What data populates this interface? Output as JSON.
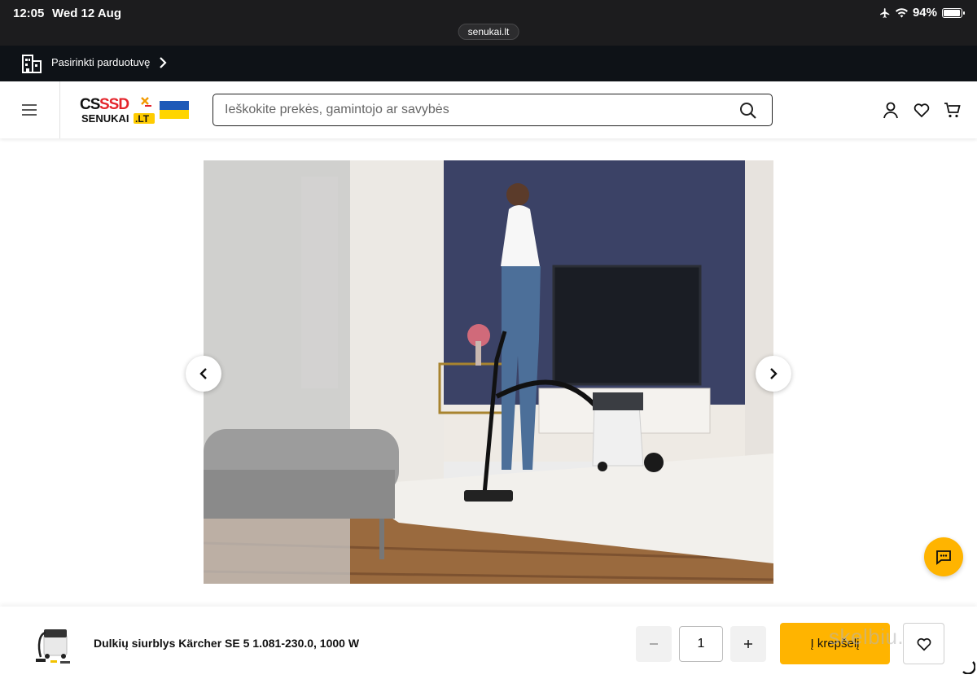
{
  "status_bar": {
    "time": "12:05",
    "date": "Wed 12 Aug",
    "battery": "94%",
    "battery_level": 0.94
  },
  "browser": {
    "url": "senukai.lt"
  },
  "store_bar": {
    "label": "Pasirinkti parduotuvę"
  },
  "header": {
    "search_placeholder": "Ieškokite prekės, gamintojo ar savybės",
    "logo_text": "SENUKAI.LT"
  },
  "product": {
    "name": "Dulkių siurblys Kärcher SE 5 1.081-230.0, 1000 W",
    "quantity": "1",
    "add_to_cart_label": "Į krepšelį"
  },
  "watermark": "skelbiu.lt",
  "colors": {
    "accent": "#ffb400",
    "dark_bar": "#0e1217",
    "status_bar": "#1c1c1e",
    "wall_blue": "#3b4266"
  }
}
